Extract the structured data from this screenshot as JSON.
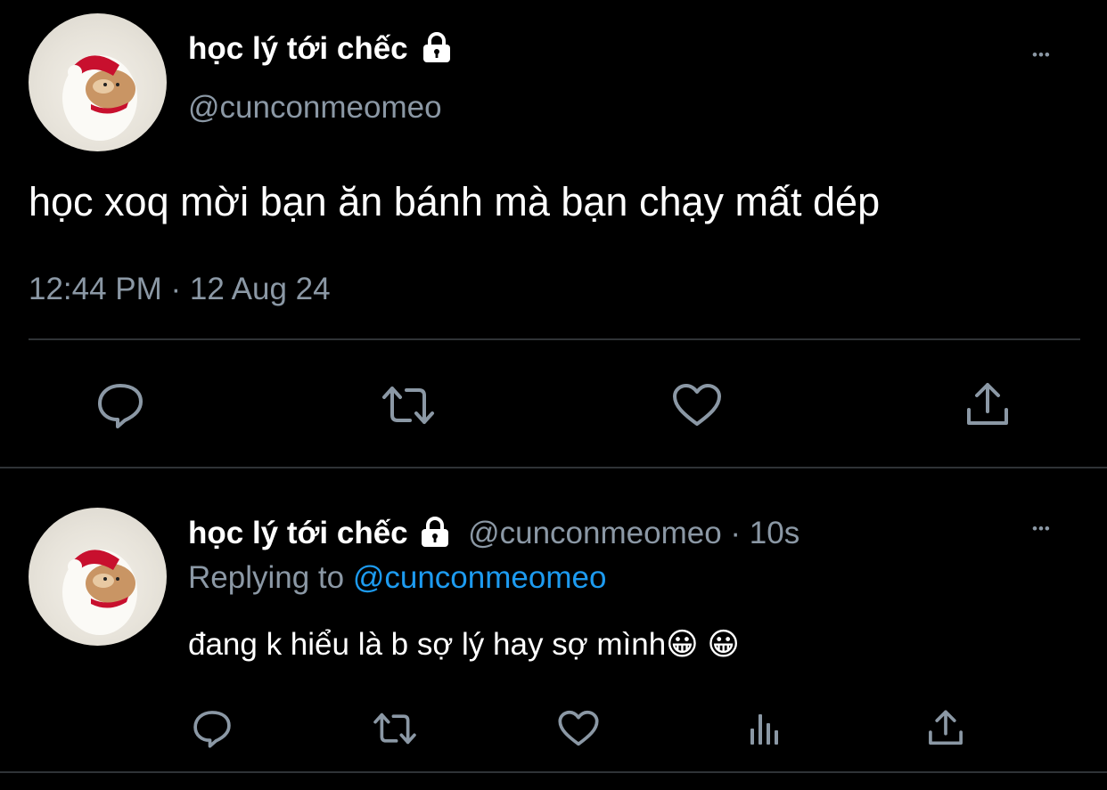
{
  "main_tweet": {
    "display_name": "học lý tới chếc",
    "handle": "@cunconmeomeo",
    "text": "học xoq mời bạn ăn bánh mà bạn chạy mất dép",
    "timestamp": "12:44 PM · 12 Aug 24",
    "more_glyph": "•••",
    "actions": [
      "reply-icon",
      "retweet-icon",
      "like-icon",
      "share-icon"
    ]
  },
  "reply_tweet": {
    "display_name": "học lý tới chếc",
    "handle_time": "@cunconmeomeo · 10s",
    "replying_prefix": "Replying to",
    "replying_handle": "@cunconmeomeo",
    "text": "đang k hiểu là b sợ lý hay sợ mình😀 😀",
    "more_glyph": "•••",
    "actions": [
      "reply-icon",
      "retweet-icon",
      "like-icon",
      "analytics-icon",
      "share-icon"
    ]
  },
  "colors": {
    "background": "#000000",
    "text": "#ffffff",
    "muted": "#8b98a5",
    "link": "#1d9bf0",
    "divider": "#2f3336"
  }
}
